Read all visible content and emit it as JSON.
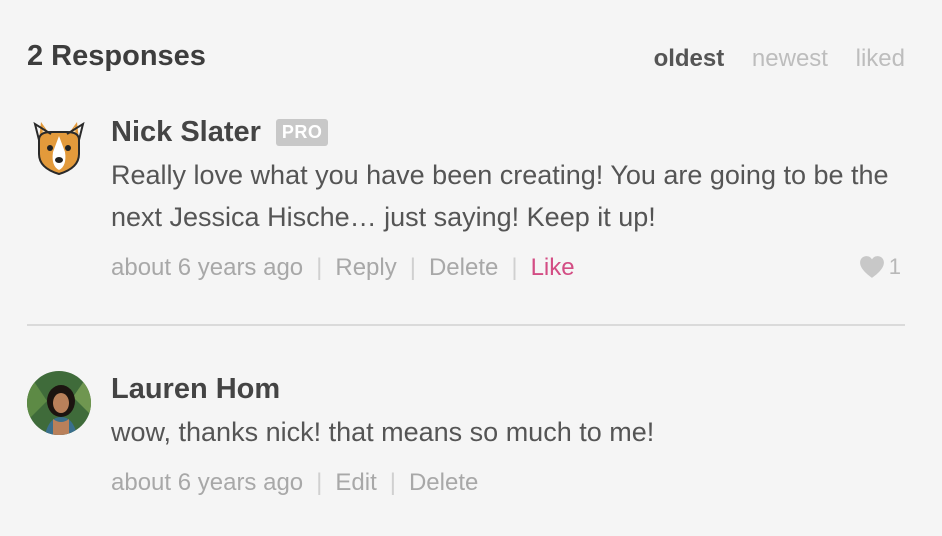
{
  "header": {
    "title": "2 Responses",
    "sort_options": [
      "oldest",
      "newest",
      "liked"
    ],
    "active_sort": "oldest"
  },
  "comments": [
    {
      "author": "Nick Slater",
      "badge": "PRO",
      "avatar_icon": "corgi-dog-icon",
      "text": "Really love what you have been creating! You are going to be the next Jessica Hische… just saying! Keep it up!",
      "timestamp": "about 6 years ago",
      "actions": [
        "Reply",
        "Delete",
        "Like"
      ],
      "like_count": "1"
    },
    {
      "author": "Lauren Hom",
      "avatar_icon": "user-photo-avatar",
      "text": "wow, thanks nick! that means so much to me!",
      "timestamp": "about 6 years ago",
      "actions": [
        "Edit",
        "Delete"
      ]
    }
  ],
  "colors": {
    "like_accent": "#d34d84",
    "muted_text": "#a8a8a8",
    "badge_bg": "#c8c8c8"
  }
}
